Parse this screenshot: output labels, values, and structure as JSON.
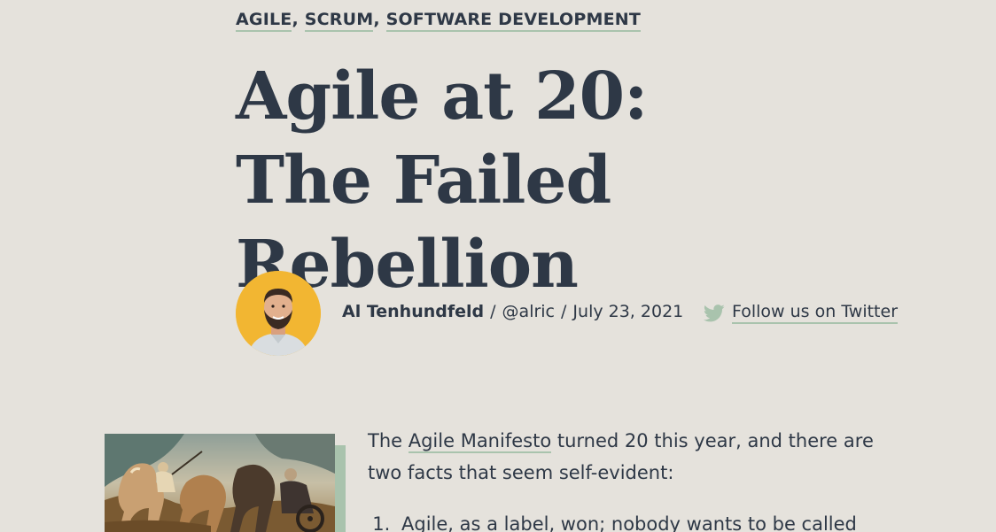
{
  "categories": [
    "AGILE",
    "SCRUM",
    "SOFTWARE DEVELOPMENT"
  ],
  "category_separator": ",",
  "title": "Agile at 20: The Failed Rebellion",
  "author": {
    "name": "Al Tenhundfeld",
    "handle": "@alric",
    "date": "July 23, 2021",
    "separator": "/"
  },
  "twitter": {
    "icon": "twitter-bird-icon",
    "label": "Follow us on Twitter",
    "color": "#a9c3ad"
  },
  "article": {
    "intro_before": "The ",
    "intro_link": "Agile Manifesto",
    "intro_after": " turned 20 this year, and there are two facts that seem self-evident:",
    "list": [
      "Agile, as a label, won; nobody wants to be called"
    ]
  },
  "colors": {
    "background": "#e5e2dc",
    "text": "#2e3846",
    "accent": "#a9c3ad",
    "avatar_bg": "#f2b632"
  }
}
